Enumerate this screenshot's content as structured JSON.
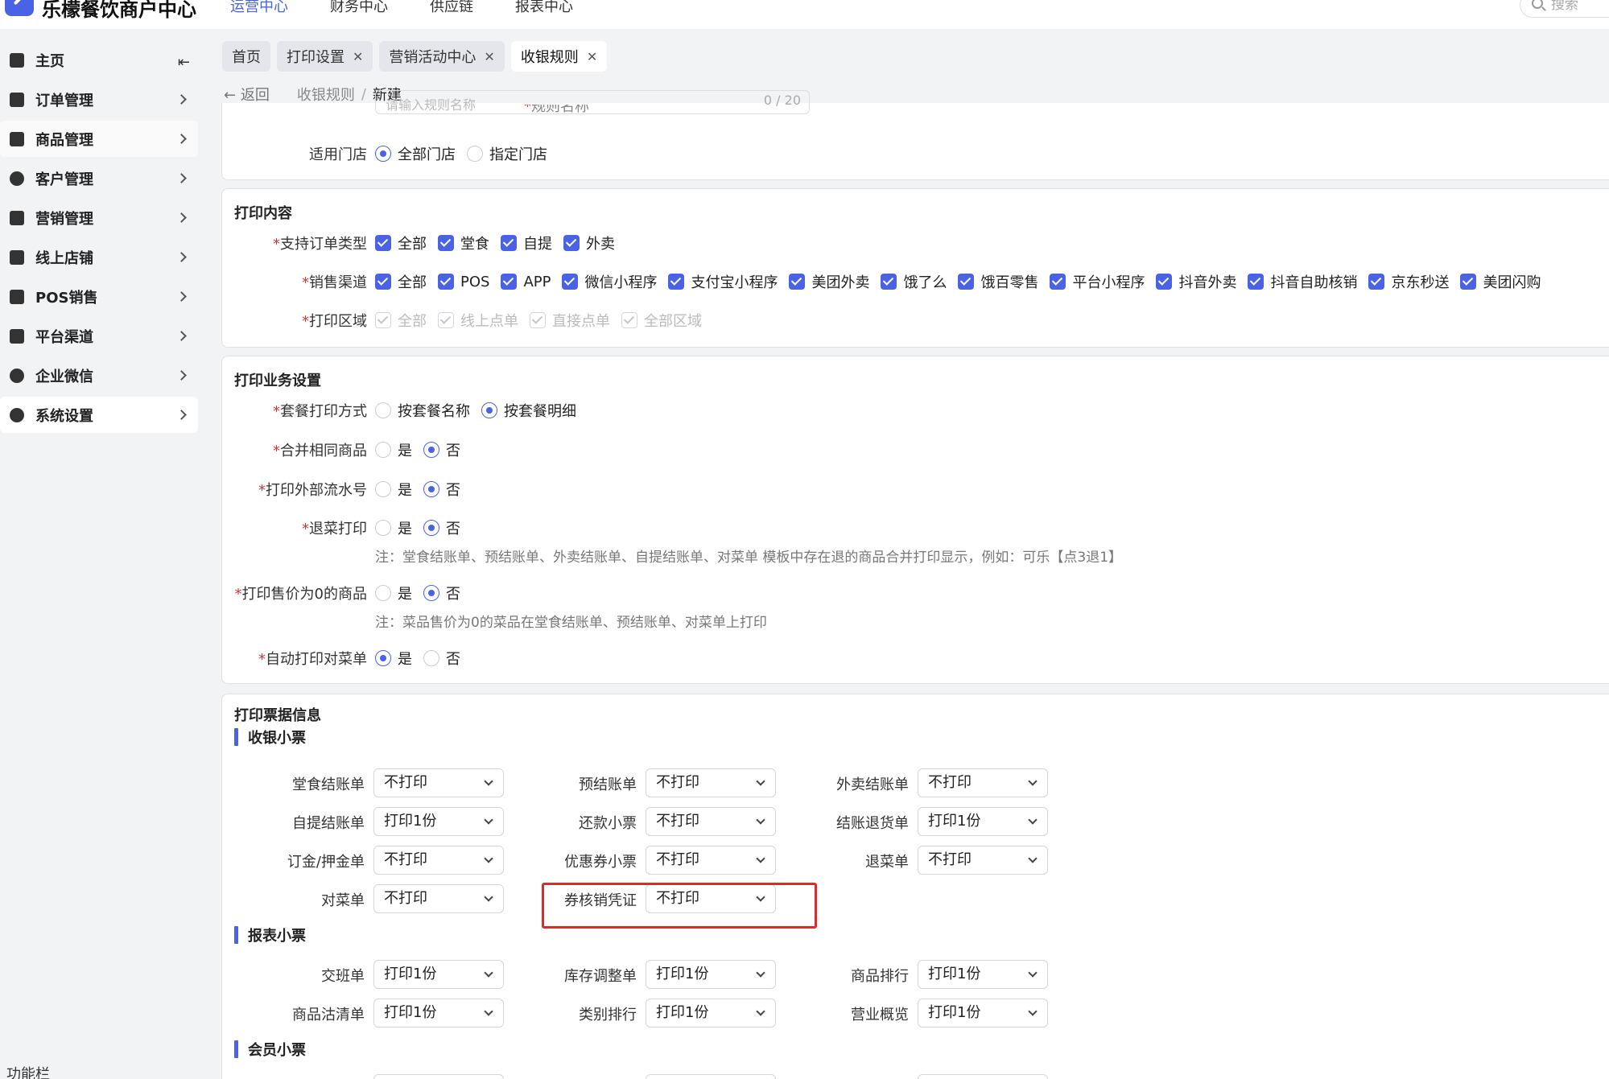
{
  "app": {
    "title": "乐檬餐饮商户中心"
  },
  "topnav": [
    "运营中心",
    "财务中心",
    "供应链",
    "报表中心"
  ],
  "search": {
    "placeholder": "搜索"
  },
  "sidebar": {
    "items": [
      {
        "label": "主页",
        "icon": "home-icon"
      },
      {
        "label": "订单管理",
        "icon": "order-icon"
      },
      {
        "label": "商品管理",
        "icon": "goods-icon"
      },
      {
        "label": "客户管理",
        "icon": "user-icon"
      },
      {
        "label": "营销管理",
        "icon": "tag-icon"
      },
      {
        "label": "线上店铺",
        "icon": "store-icon"
      },
      {
        "label": "POS销售",
        "icon": "pos-icon"
      },
      {
        "label": "平台渠道",
        "icon": "bank-icon"
      },
      {
        "label": "企业微信",
        "icon": "chat-icon"
      },
      {
        "label": "系统设置",
        "icon": "gear-icon"
      }
    ],
    "footer": "功能栏"
  },
  "tabs": [
    "首页",
    "打印设置",
    "营销活动中心",
    "收银规则"
  ],
  "breadcrumb": {
    "back": "返回",
    "parent": "收银规则",
    "sep": "/",
    "current": "新建"
  },
  "basic": {
    "name_label": "规则名称",
    "name_placeholder": "请输入规则名称",
    "name_counter": "0 / 20",
    "store_label": "适用门店",
    "store_options": [
      "全部门店",
      "指定门店"
    ]
  },
  "print_content": {
    "title": "打印内容",
    "order_type_label": "支持订单类型",
    "order_types": [
      "全部",
      "堂食",
      "自提",
      "外卖"
    ],
    "channel_label": "销售渠道",
    "channels": [
      "全部",
      "POS",
      "APP",
      "微信小程序",
      "支付宝小程序",
      "美团外卖",
      "饿了么",
      "饿百零售",
      "平台小程序",
      "抖音外卖",
      "抖音自助核销",
      "京东秒送",
      "美团闪购"
    ],
    "area_label": "打印区域",
    "areas": [
      "全部",
      "线上点单",
      "直接点单",
      "全部区域"
    ]
  },
  "business": {
    "title": "打印业务设置",
    "combo_label": "套餐打印方式",
    "combo_options": [
      "按套餐名称",
      "按套餐明细"
    ],
    "merge_label": "合并相同商品",
    "external_label": "打印外部流水号",
    "refund_label": "退菜打印",
    "refund_note": "注：堂食结账单、预结账单、外卖结账单、自提结账单、对菜单 模板中存在退的商品合并打印显示，例如：可乐【点3退1】",
    "zero_label": "打印售价为0的商品",
    "zero_note": "注：菜品售价为0的菜品在堂食结账单、预结账单、对菜单上打印",
    "auto_label": "自动打印对菜单",
    "yes": "是",
    "no": "否"
  },
  "tickets": {
    "title": "打印票据信息",
    "cashier_head": "收银小票",
    "report_head": "报表小票",
    "member_head": "会员小票",
    "cashier": [
      {
        "label": "堂食结账单",
        "value": "不打印"
      },
      {
        "label": "预结账单",
        "value": "不打印"
      },
      {
        "label": "外卖结账单",
        "value": "不打印"
      },
      {
        "label": "自提结账单",
        "value": "打印1份"
      },
      {
        "label": "还款小票",
        "value": "不打印"
      },
      {
        "label": "结账退货单",
        "value": "打印1份"
      },
      {
        "label": "订金/押金单",
        "value": "不打印"
      },
      {
        "label": "优惠券小票",
        "value": "不打印"
      },
      {
        "label": "退菜单",
        "value": "不打印"
      },
      {
        "label": "对菜单",
        "value": "不打印"
      },
      {
        "label": "券核销凭证",
        "value": "不打印"
      }
    ],
    "report": [
      {
        "label": "交班单",
        "value": "打印1份"
      },
      {
        "label": "库存调整单",
        "value": "打印1份"
      },
      {
        "label": "商品排行",
        "value": "打印1份"
      },
      {
        "label": "商品沽清单",
        "value": "打印1份"
      },
      {
        "label": "类别排行",
        "value": "打印1份"
      },
      {
        "label": "营业概览",
        "value": "打印1份"
      }
    ]
  },
  "colors": {
    "accent": "#4a62e6",
    "required": "#e03131",
    "highlight": "#e02a2a"
  }
}
